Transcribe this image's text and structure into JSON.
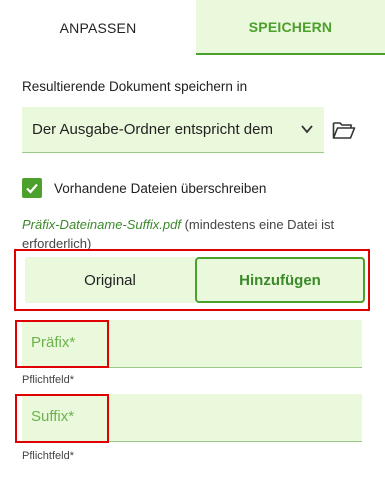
{
  "tabs": [
    {
      "label": "ANPASSEN"
    },
    {
      "label": "SPEICHERN"
    }
  ],
  "save_location": {
    "label": "Resultierende Dokument speichern in",
    "selected": "Der Ausgabe-Ordner entspricht dem"
  },
  "overwrite": {
    "label": "Vorhandene Dateien überschreiben",
    "checked": true
  },
  "hint": {
    "italic": "Präfix-Dateiname-Suffix.pdf",
    "rest": " (mindestens eine Datei ist erforderlich)"
  },
  "mode_toggle": {
    "options": [
      "Original",
      "Hinzufügen"
    ],
    "selected": "Hinzufügen"
  },
  "prefix_field": {
    "label": "Präfix*",
    "helper": "Pflichtfeld*"
  },
  "suffix_field": {
    "label": "Suffix*",
    "helper": "Pflichtfeld*"
  },
  "colors": {
    "accent": "#4ca02c",
    "field_bg": "#eaf8dc",
    "highlight": "#e00000"
  }
}
